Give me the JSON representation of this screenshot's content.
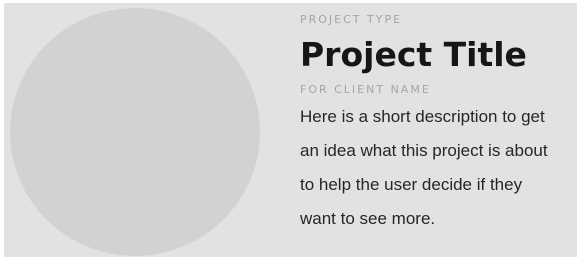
{
  "card": {
    "project_type": "PROJECT TYPE",
    "title": "Project Title",
    "client": "FOR CLIENT NAME",
    "description_lines": [
      "Here is a short description to get",
      "an idea what this project is about",
      "to help the user decide if they",
      "want to see more."
    ]
  },
  "colors": {
    "card_background": "#e2e2e2",
    "thumbnail_placeholder": "#d2d2d2",
    "title": "#161616",
    "eyebrow": "#a5a5a5",
    "body_text": "#262626"
  }
}
